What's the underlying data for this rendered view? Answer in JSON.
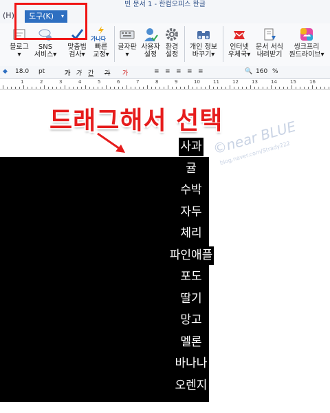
{
  "window": {
    "title": "빈 문서 1 - 한컴오피스 한글"
  },
  "menubar": {
    "prev_menu": "(H)",
    "active_menu": "도구(K)",
    "caret": "▾"
  },
  "ribbon": {
    "buttons": [
      {
        "id": "blog",
        "label1": "블로그",
        "label2": "▾"
      },
      {
        "id": "sns",
        "label1": "SNS",
        "label2": "서비스▾"
      },
      {
        "id": "spell",
        "label1": "맞춤법",
        "label2": "검사▾"
      },
      {
        "id": "quick",
        "label1": "빠른",
        "label2": "교정▾"
      },
      {
        "id": "charmap",
        "label1": "글자판",
        "label2": "▾"
      },
      {
        "id": "userset",
        "label1": "사용자",
        "label2": "설정"
      },
      {
        "id": "envset",
        "label1": "환경",
        "label2": "설정"
      },
      {
        "id": "privacy",
        "label1": "개인 정보",
        "label2": "바꾸기▾"
      },
      {
        "id": "internet",
        "label1": "인터넷",
        "label2": "우체국▾"
      },
      {
        "id": "docform",
        "label1": "문서 서식",
        "label2": "내려받기"
      },
      {
        "id": "thinkfree",
        "label1": "씽크프리",
        "label2": "원드라이브▾"
      }
    ],
    "quick_icon_text": "가나다"
  },
  "format": {
    "font_size": "18.0",
    "unit": "pt",
    "bold": "가",
    "italic": "가",
    "underline": "간",
    "strike": "가",
    "color": "가",
    "zoom": "160",
    "zoom_unit": "%"
  },
  "ruler": {
    "numbers": [
      "1",
      "2",
      "3",
      "4",
      "5",
      "6",
      "7",
      "8",
      "9",
      "10",
      "11",
      "12",
      "13",
      "14",
      "15",
      "16"
    ]
  },
  "annotation": {
    "text": "드래그해서 선택"
  },
  "watermark": {
    "line1": "©near BLUE",
    "line2": "blog.naver.com/Strady222"
  },
  "fruits": [
    "사과",
    "귤",
    "수박",
    "자두",
    "체리",
    "파인애플",
    "포도",
    "딸기",
    "망고",
    "멜론",
    "바나나",
    "오렌지"
  ]
}
